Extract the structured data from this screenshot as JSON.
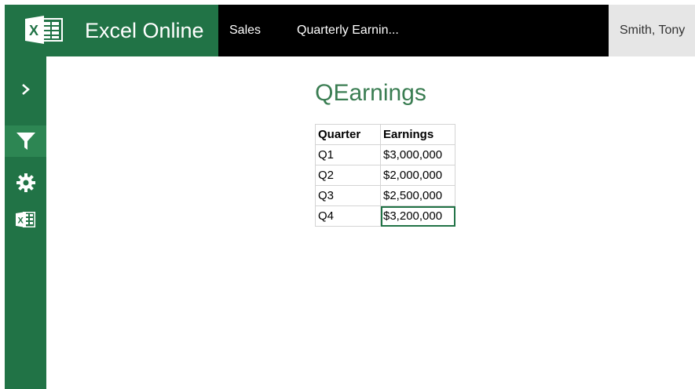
{
  "header": {
    "app_name": "Excel Online",
    "breadcrumbs": [
      "Sales",
      "Quarterly Earnin..."
    ],
    "user_name": "Smith, Tony"
  },
  "rail": {
    "items": [
      {
        "icon": "chevron-right-icon"
      },
      {
        "icon": "filter-icon",
        "active": true
      },
      {
        "icon": "gear-icon"
      },
      {
        "icon": "excel-icon"
      }
    ]
  },
  "sheet": {
    "title": "QEarnings",
    "columns": [
      "Quarter",
      "Earnings"
    ],
    "rows": [
      [
        "Q1",
        "$3,000,000"
      ],
      [
        "Q2",
        "$2,000,000"
      ],
      [
        "Q3",
        "$2,500,000"
      ],
      [
        "Q4",
        "$3,200,000"
      ]
    ],
    "selected_cell": "Q4 Earnings"
  },
  "colors": {
    "brand": "#217346",
    "topbar": "#000000",
    "title": "#3a7d52"
  }
}
